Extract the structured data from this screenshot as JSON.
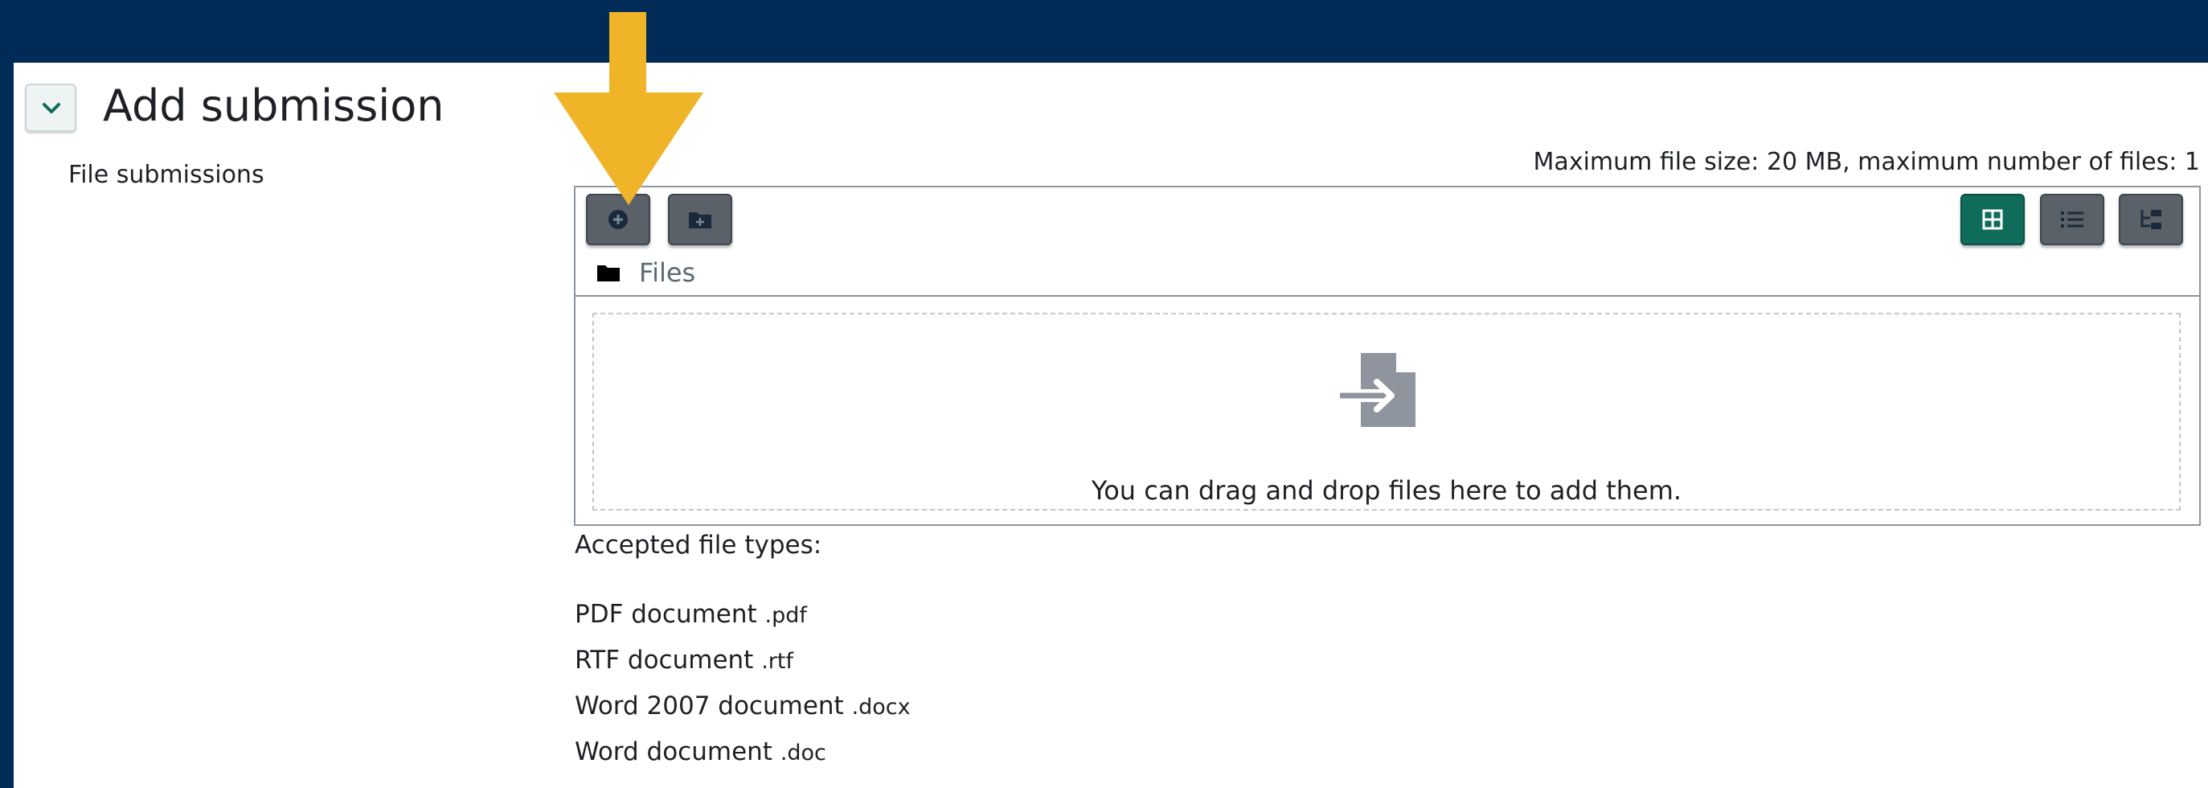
{
  "section": {
    "title": "Add submission",
    "field_label": "File submissions"
  },
  "filemanager": {
    "limits_text": "Maximum file size: 20 MB, maximum number of files: 1",
    "toolbar": {
      "add_file_icon": "plus-circle-icon",
      "create_folder_icon": "folder-plus-icon",
      "view_icons_icon": "grid-icon",
      "view_list_icon": "list-icon",
      "view_tree_icon": "tree-icon"
    },
    "breadcrumb_label": "Files",
    "drop_hint": "You can drag and drop files here to add them."
  },
  "accepted": {
    "label": "Accepted file types:",
    "types": [
      {
        "name": "PDF document",
        "ext": ".pdf"
      },
      {
        "name": "RTF document",
        "ext": ".rtf"
      },
      {
        "name": "Word 2007 document",
        "ext": ".docx"
      },
      {
        "name": "Word document",
        "ext": ".doc"
      }
    ]
  },
  "colors": {
    "frame": "#002b57",
    "arrow": "#f0b429",
    "active_view": "#0f6b5a",
    "toolbar_button": "#5a6168"
  }
}
